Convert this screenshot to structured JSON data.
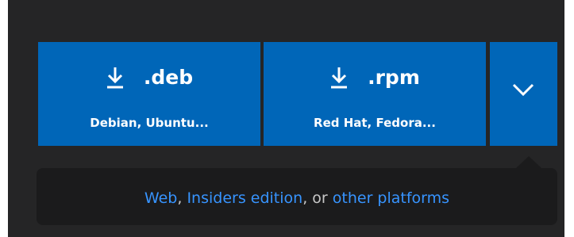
{
  "download": {
    "deb": {
      "title": ".deb",
      "subtitle": "Debian, Ubuntu..."
    },
    "rpm": {
      "title": ".rpm",
      "subtitle": "Red Hat, Fedora..."
    },
    "more_icon": "chevron-down-icon",
    "download_icon": "download-arrow-icon"
  },
  "other_links": {
    "web": "Web",
    "comma": ", ",
    "insiders": "Insiders edition",
    "or": ", or ",
    "platforms": "other platforms"
  },
  "colors": {
    "background": "#252526",
    "button": "#0066b8",
    "link": "#3794ff",
    "muted_text": "#c8c8c8",
    "popover": "#1b1b1c"
  }
}
